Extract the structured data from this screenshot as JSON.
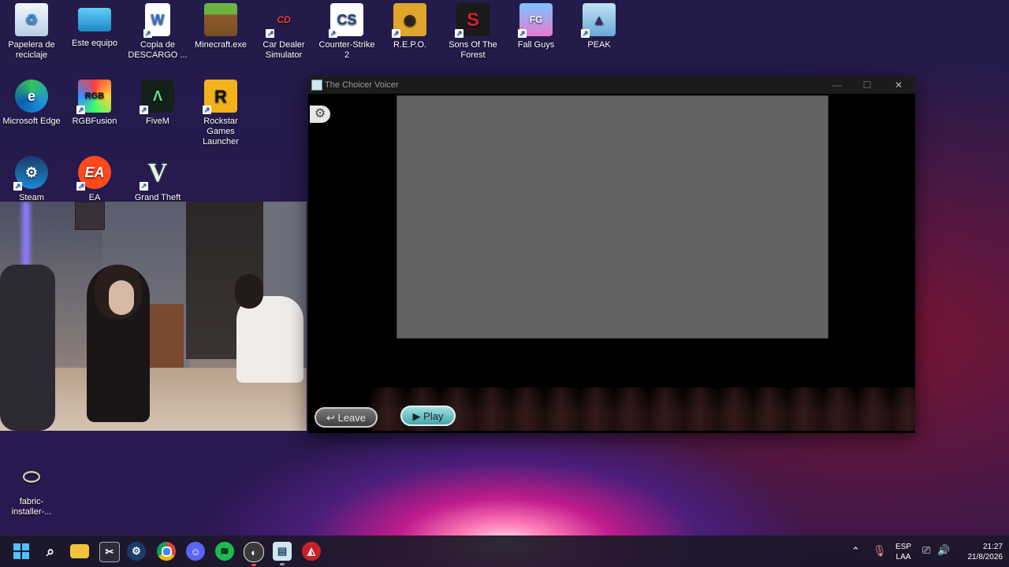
{
  "desktop": {
    "icons": [
      {
        "label": "Papelera de reciclaje",
        "icon": "recycle-bin-icon",
        "color": "#d8e6f5"
      },
      {
        "label": "Este equipo",
        "icon": "computer-icon",
        "color": "#2aa5d8"
      },
      {
        "label": "Copia de DESCARGO ...",
        "icon": "word-document-icon",
        "color": "#2b6fd6"
      },
      {
        "label": "Minecraft.exe",
        "icon": "minecraft-icon",
        "color": "#5e9c3a"
      },
      {
        "label": "Car Dealer Simulator",
        "icon": "car-dealer-icon",
        "color": "#3a6ec7"
      },
      {
        "label": "Counter-Strike 2",
        "icon": "counter-strike-icon",
        "color": "#f4a81d"
      },
      {
        "label": "R.E.P.O.",
        "icon": "repo-icon",
        "color": "#e0a52b"
      },
      {
        "label": "Sons Of The Forest",
        "icon": "sons-of-the-forest-icon",
        "color": "#b41e2a"
      },
      {
        "label": "Fall Guys",
        "icon": "fall-guys-icon",
        "color": "#5aa0e8"
      },
      {
        "label": "PEAK",
        "icon": "peak-icon",
        "color": "#7fb6e0"
      },
      {
        "label": "Microsoft Edge",
        "icon": "edge-icon",
        "color": "#1f8fd8"
      },
      {
        "label": "RGBFusion",
        "icon": "rgbfusion-icon",
        "color": "#2c2c2c"
      },
      {
        "label": "FiveM",
        "icon": "fivem-icon",
        "color": "#1c2b22"
      },
      {
        "label": "Rockstar Games Launcher",
        "icon": "rockstar-icon",
        "color": "#f3b11c"
      },
      {
        "label": "Steam",
        "icon": "steam-icon",
        "color": "#1b4a7a"
      },
      {
        "label": "EA",
        "icon": "ea-icon",
        "color": "#ff4a1c"
      },
      {
        "label": "Grand Theft Auto",
        "icon": "gta-icon",
        "color": "#3a3a3a"
      },
      {
        "label": "fabric-installer-...",
        "icon": "jar-file-icon",
        "color": "#c9b89a"
      }
    ]
  },
  "window": {
    "title": "The Choicer Voicer",
    "leave_label": "Leave",
    "play_label": "Play",
    "settings_icon": "gear-icon"
  },
  "taskbar": {
    "apps": [
      "start-icon",
      "search-icon",
      "file-explorer-icon",
      "snipping-tool-icon",
      "steam-icon",
      "chrome-icon",
      "discord-icon",
      "spotify-icon",
      "obs-icon",
      "notepad-icon",
      "apex-icon"
    ],
    "lang_top": "ESP",
    "lang_bottom": "LAA",
    "time": "21:27",
    "date": "21/8/2026"
  }
}
